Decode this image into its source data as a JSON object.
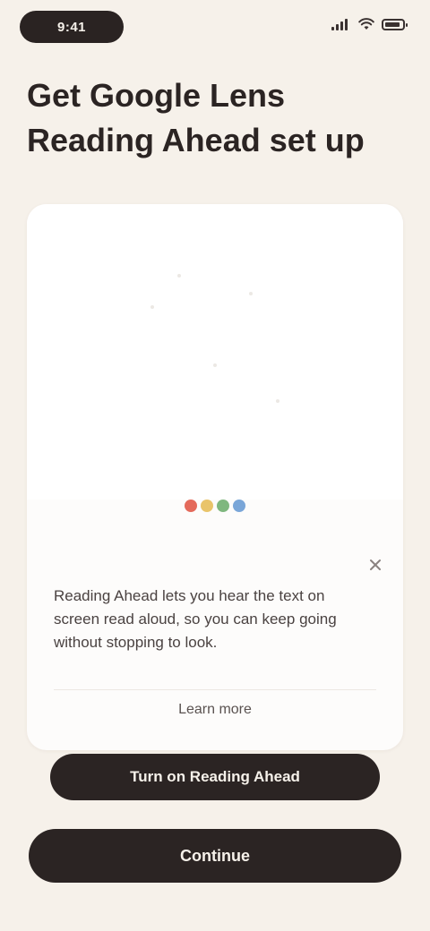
{
  "status_bar": {
    "time": "9:41"
  },
  "headline": "Get Google Lens Reading Ahead set up",
  "card": {
    "body": "Reading Ahead lets you hear the text on screen read aloud, so you can keep going without stopping to look.",
    "link_label": "Learn more"
  },
  "primary_button_label": "Turn on Reading Ahead",
  "continue_button_label": "Continue",
  "colors": {
    "background": "#f6f1ea",
    "card": "#fdfcfb",
    "button": "#2b2423",
    "logo_red": "#e46a5b",
    "logo_yellow": "#e9c46a",
    "logo_green": "#7fb77e",
    "logo_blue": "#7aa6d8"
  },
  "icons": {
    "signal": "signal-icon",
    "wifi": "wifi-icon",
    "battery": "battery-icon",
    "close": "close-icon",
    "logo": "google-logo-icon"
  }
}
